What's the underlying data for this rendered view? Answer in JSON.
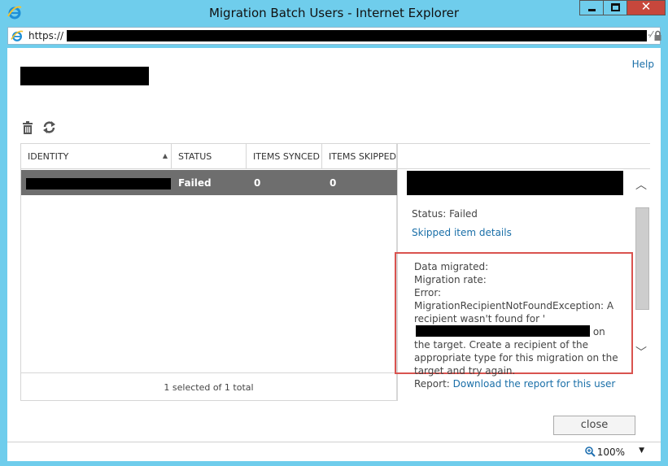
{
  "window": {
    "title": "Migration Batch Users - Internet Explorer",
    "close_glyph": "✕"
  },
  "address": {
    "prefix": "https://",
    "trailing": "-⁄",
    "secure": true
  },
  "page": {
    "help_label": "Help",
    "toolbar": {
      "delete_icon": "trash-icon",
      "refresh_icon": "refresh-icon"
    }
  },
  "grid": {
    "columns": [
      "IDENTITY",
      "STATUS",
      "ITEMS SYNCED",
      "ITEMS SKIPPED"
    ],
    "sort_indicator": "▲",
    "rows": [
      {
        "identity": "[redacted]",
        "status": "Failed",
        "items_synced": "0",
        "items_skipped": "0"
      }
    ],
    "footer": "1 selected of 1 total"
  },
  "details": {
    "status": "Status: Failed",
    "skipped_link": "Skipped item details",
    "data_migrated": "Data migrated:",
    "migration_rate": "Migration rate:",
    "error_part1": "Error: MigrationRecipientNotFoundException: A recipient wasn't found for '",
    "error_part2": "on the target. Create a recipient of the appropriate type for this migration on the target and try again.",
    "report_label": "Report:",
    "report_link": "Download the report for this user"
  },
  "buttons": {
    "close_label": "close"
  },
  "statusbar": {
    "zoom": "100%"
  },
  "colors": {
    "titlebar": "#6fcdec",
    "link": "#1a6fa8",
    "selected_row": "#6e6e6e",
    "highlight_box": "#d9534f",
    "close_button": "#c7473c"
  }
}
